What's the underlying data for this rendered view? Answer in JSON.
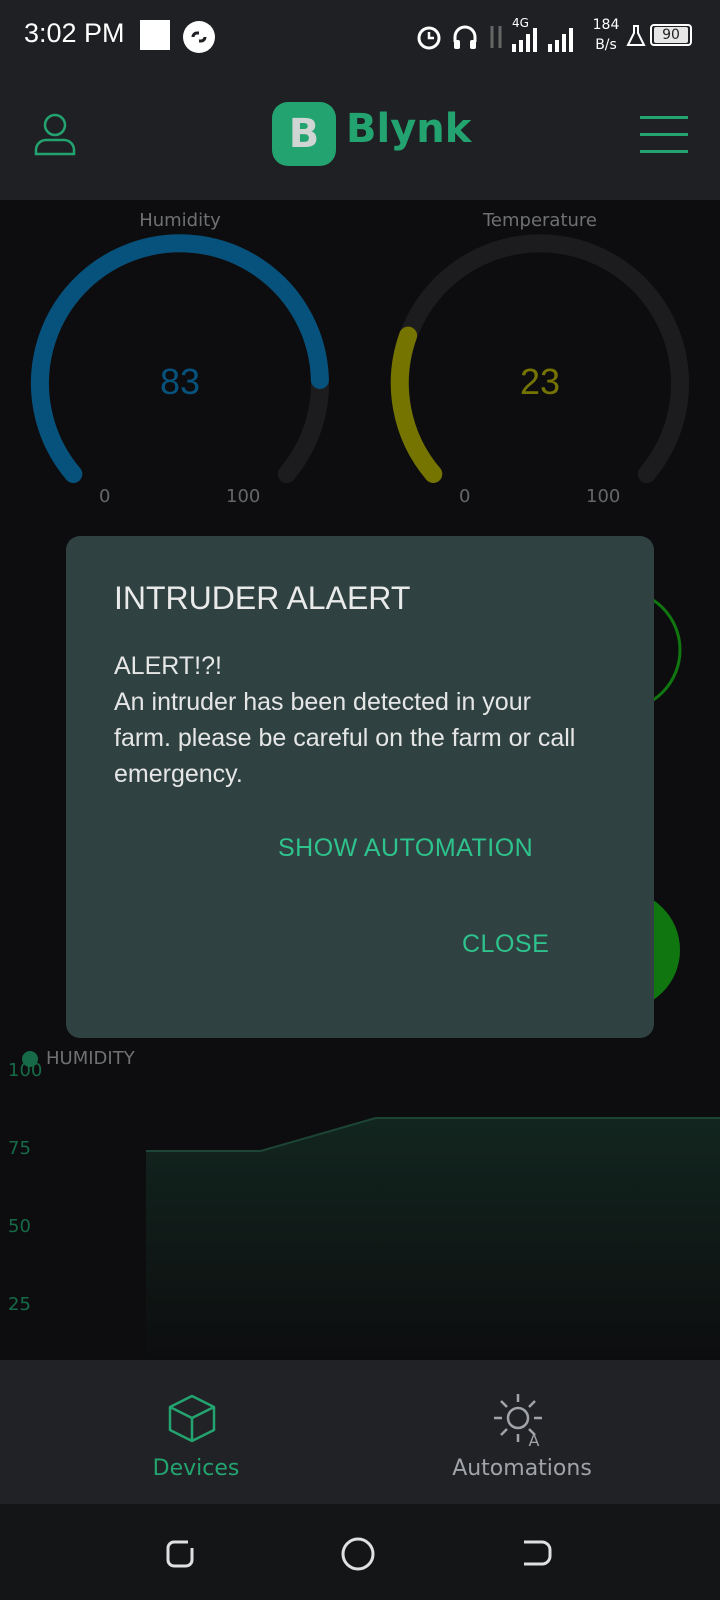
{
  "status_bar": {
    "time": "3:02 PM",
    "network": "4G",
    "speed_value": "184",
    "speed_unit": "B/s",
    "battery": "90"
  },
  "app_bar": {
    "logo_letter": "B",
    "logo_text": "Blynk"
  },
  "gauges": [
    {
      "label": "Humidity",
      "value": "83",
      "min": "0",
      "max": "100",
      "color": "#0a7fbf"
    },
    {
      "label": "Temperature",
      "value": "23",
      "min": "0",
      "max": "100",
      "color": "#b5b300"
    }
  ],
  "chart_data": {
    "type": "area",
    "title": "",
    "series": [
      {
        "name": "HUMIDITY",
        "color": "#23a36f",
        "values": [
          73,
          73,
          84,
          84,
          84,
          84
        ]
      }
    ],
    "y_ticks": [
      "100",
      "75",
      "50",
      "25"
    ],
    "ylim": [
      0,
      100
    ]
  },
  "dialog": {
    "title": "INTRUDER ALAERT",
    "body": "ALERT!?!\nAn intruder has been detected in your farm. please be careful on the farm or call emergency.",
    "show_automation_label": "SHOW AUTOMATION",
    "close_label": "CLOSE"
  },
  "bottom_nav": {
    "devices_label": "Devices",
    "automations_label": "Automations",
    "active_color": "#23a36f",
    "inactive_color": "#a0a3a7"
  },
  "icons": [
    "user-icon",
    "menu-icon",
    "alarm-icon",
    "headphones-icon",
    "signal-icon",
    "battery-icon",
    "device-cube-icon",
    "automation-sun-icon"
  ]
}
